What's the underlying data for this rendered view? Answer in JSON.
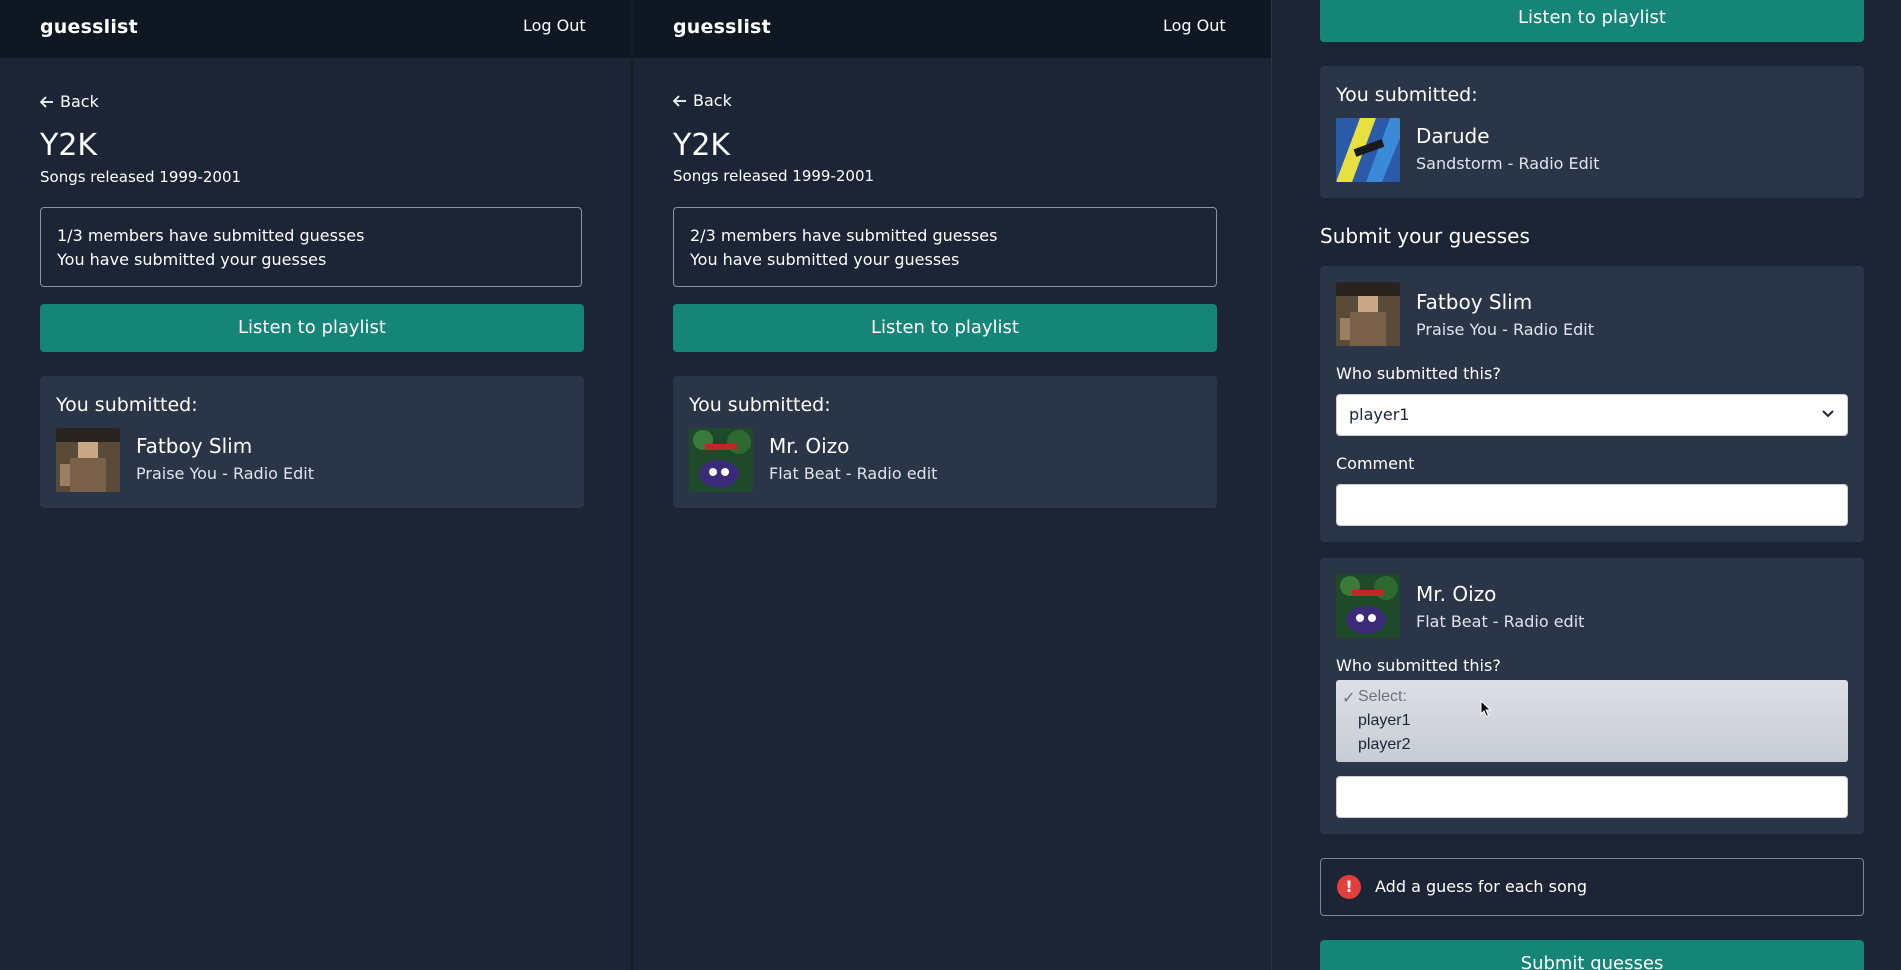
{
  "app": {
    "brand": "guesslist",
    "logout_label": "Log Out",
    "back_label": "Back"
  },
  "round": {
    "title": "Y2K",
    "subtitle": "Songs released 1999-2001"
  },
  "pane1": {
    "status_line1": "1/3 members have submitted guesses",
    "status_line2": "You have submitted your guesses",
    "listen_label": "Listen to playlist",
    "submitted_label": "You submitted:",
    "track": {
      "artist": "Fatboy Slim",
      "title": "Praise You - Radio Edit"
    }
  },
  "pane2": {
    "status_line1": "2/3 members have submitted guesses",
    "status_line2": "You have submitted your guesses",
    "listen_label": "Listen to playlist",
    "submitted_label": "You submitted:",
    "track": {
      "artist": "Mr. Oizo",
      "title": "Flat Beat - Radio edit"
    }
  },
  "pane3": {
    "listen_label": "Listen to playlist",
    "submitted_label": "You submitted:",
    "submitted_track": {
      "artist": "Darude",
      "title": "Sandstorm - Radio Edit"
    },
    "section_title": "Submit your guesses",
    "guesses": [
      {
        "artist": "Fatboy Slim",
        "title": "Praise You - Radio Edit",
        "who_label": "Who submitted this?",
        "selected": "player1",
        "comment_label": "Comment",
        "comment_value": ""
      },
      {
        "artist": "Mr. Oizo",
        "title": "Flat Beat - Radio edit",
        "who_label": "Who submitted this?",
        "options": [
          "Select:",
          "player1",
          "player2"
        ],
        "check_mark": "✓",
        "comment_value": ""
      }
    ],
    "alert_icon": "!",
    "alert_text": "Add a guess for each song",
    "submit_label": "Submit guesses"
  },
  "colors": {
    "background": "#1b2536",
    "header": "#0f1722",
    "card": "#2b3548",
    "accent_green": "#148577",
    "alert_red": "#e43d3d"
  },
  "icons": [
    "arrow-left-icon",
    "chevron-down-icon",
    "alert-icon",
    "mouse-cursor-icon"
  ]
}
